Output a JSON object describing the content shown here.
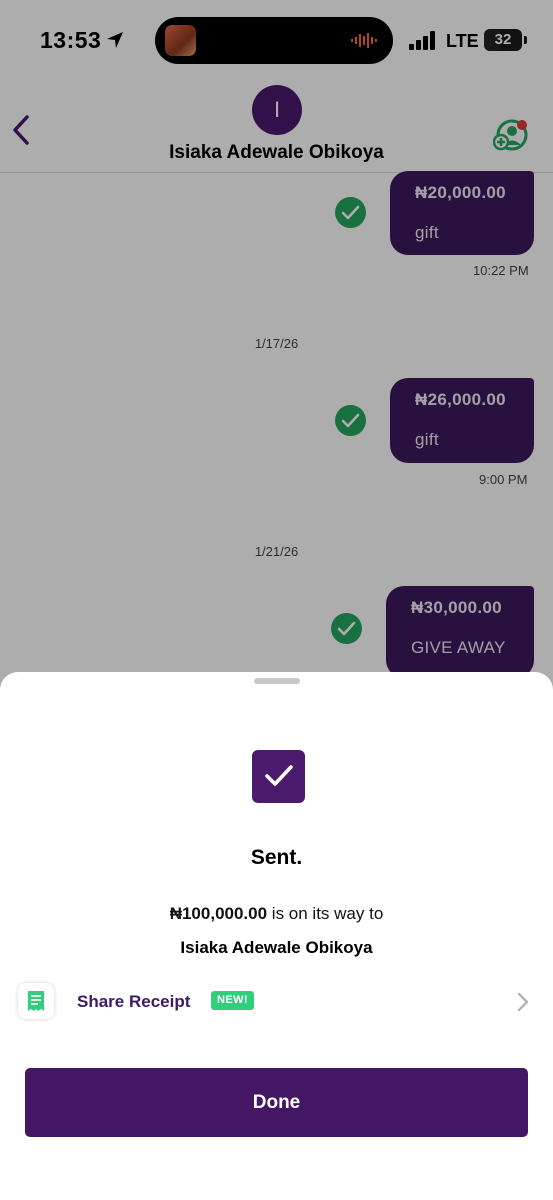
{
  "status_bar": {
    "time": "13:53",
    "network": "LTE",
    "battery": "32"
  },
  "header": {
    "avatar_initial": "I",
    "contact_name": "Isiaka Adewale Obikoya"
  },
  "chat": {
    "messages": [
      {
        "amount": "₦20,000.00",
        "note": "gift",
        "time": "10:22 PM"
      },
      {
        "date": "1/17/26",
        "amount": "₦26,000.00",
        "note": "gift",
        "time": "9:00 PM"
      },
      {
        "date": "1/21/26",
        "amount": "₦30,000.00",
        "note": "GIVE AWAY"
      }
    ]
  },
  "sheet": {
    "title": "Sent.",
    "amount": "₦100,000.00",
    "message_suffix": " is on its way to",
    "recipient": "Isiaka Adewale Obikoya",
    "share_label": "Share Receipt",
    "new_badge": "NEW!",
    "done_label": "Done"
  },
  "colors": {
    "brand_purple": "#431763",
    "success_green": "#25a560",
    "badge_green": "#2fcf7c"
  },
  "icons": [
    "location-arrow-icon",
    "signal-icon",
    "battery-icon",
    "back-icon",
    "add-user-icon",
    "checkmark-icon",
    "receipt-icon",
    "chevron-right-icon"
  ]
}
